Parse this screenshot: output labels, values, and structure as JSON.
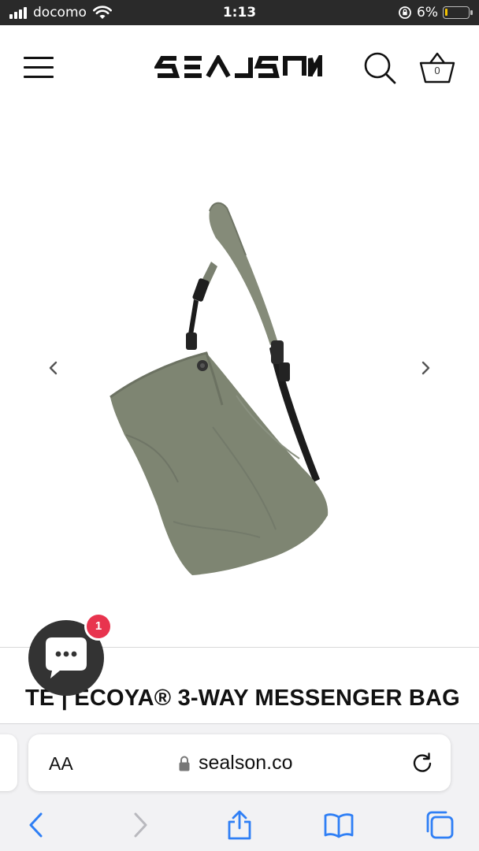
{
  "status_bar": {
    "carrier": "docomo",
    "time": "1:13",
    "battery_percent": "6%",
    "battery_level": 0.06,
    "icons": [
      "signal-bars-icon",
      "wifi-icon",
      "orientation-lock-icon",
      "battery-icon"
    ]
  },
  "header": {
    "logo_text": "SEALSON",
    "cart_count": "0",
    "icons": [
      "hamburger-menu-icon",
      "search-icon",
      "cart-basket-icon"
    ]
  },
  "product": {
    "title": "TE | ECOYA® 3-WAY MESSENGER BAG",
    "image_alt": "olive green messenger bag"
  },
  "chat": {
    "badge_count": "1",
    "icon": "chat-bubble-icon"
  },
  "browser": {
    "text_size_label": "AA",
    "url": "sealson.co",
    "icons": [
      "lock-icon",
      "reload-icon",
      "back-icon",
      "forward-icon",
      "share-icon",
      "bookmarks-icon",
      "tabs-icon"
    ]
  },
  "colors": {
    "status_bar_bg": "#2a2a2a",
    "bag_olive": "#7e8572",
    "chat_bg": "#333333",
    "badge_red": "#e8344e",
    "safari_blue": "#2f7ff5"
  }
}
